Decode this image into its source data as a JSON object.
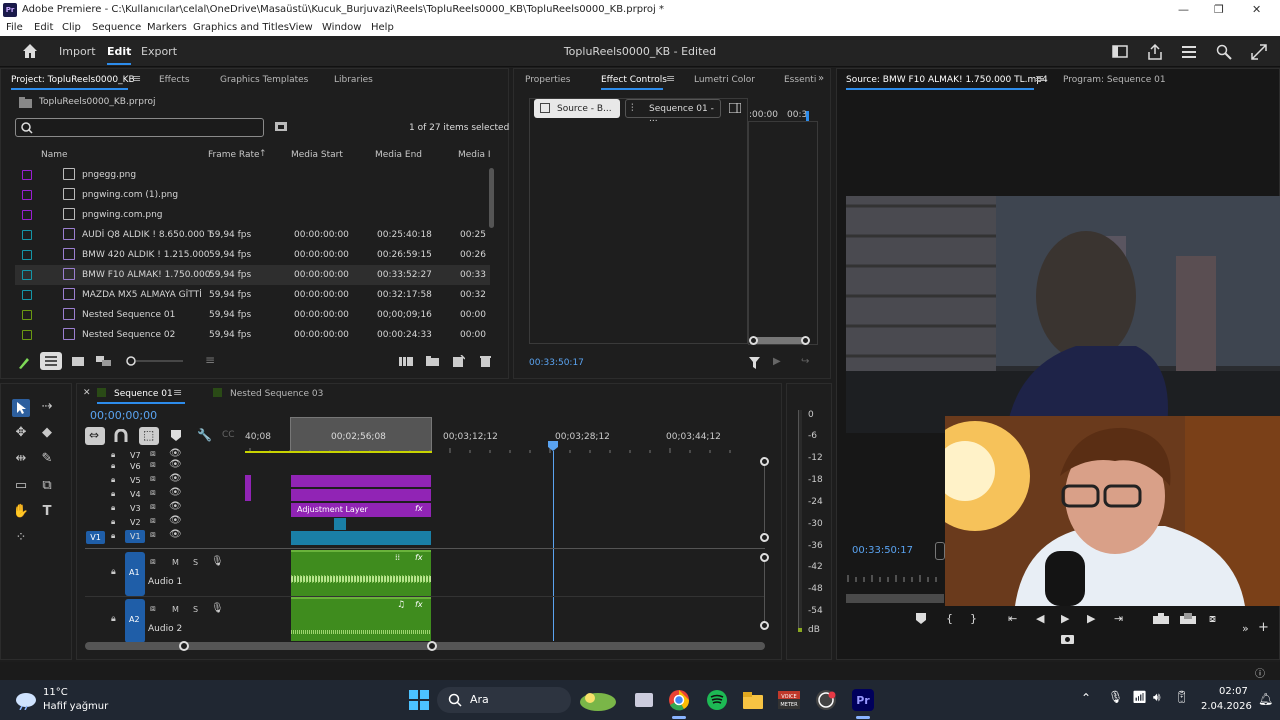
{
  "window": {
    "title": "Adobe Premiere - C:\\Kullanıcılar\\celal\\OneDrive\\Masaüstü\\Kucuk_Burjuvazi\\Reels\\TopluReels0000_KB\\TopluReels0000_KB.prproj *",
    "logo": "Pr"
  },
  "menu": [
    "File",
    "Edit",
    "Clip",
    "Sequence",
    "Markers",
    "Graphics and Titles",
    "View",
    "Window",
    "Help"
  ],
  "header": {
    "import": "Import",
    "edit": "Edit",
    "export": "Export",
    "project_title": "TopluReels0000_KB - Edited"
  },
  "project_panel": {
    "tabs": [
      "Project: TopluReels0000_KB",
      "Effects",
      "Graphics Templates",
      "Libraries"
    ],
    "file": "TopluReels0000_KB.prproj",
    "search_placeholder": "",
    "items_selected": "1 of 27 items selected",
    "columns": [
      "Name",
      "Frame Rate",
      "Media Start",
      "Media End",
      "Media I"
    ],
    "rows": [
      {
        "name": "pngegg.png",
        "fps": "",
        "start": "",
        "end": "",
        "dur": "",
        "color": "#9b1fd4"
      },
      {
        "name": "pngwing.com (1).png",
        "fps": "",
        "start": "",
        "end": "",
        "dur": "",
        "color": "#9b1fd4"
      },
      {
        "name": "pngwing.com.png",
        "fps": "",
        "start": "",
        "end": "",
        "dur": "",
        "color": "#9b1fd4"
      },
      {
        "name": "AUDİ Q8 ALDIK ! 8.650.000 T",
        "fps": "59,94 fps",
        "start": "00:00:00:00",
        "end": "00:25:40:18",
        "dur": "00:25",
        "color": "#1496a8"
      },
      {
        "name": "BMW 420 ALDIK ! 1.215.000",
        "fps": "59,94 fps",
        "start": "00:00:00:00",
        "end": "00:26:59:15",
        "dur": "00:26",
        "color": "#1496a8"
      },
      {
        "name": "BMW F10 ALMAK! 1.750.000",
        "fps": "59,94 fps",
        "start": "00:00:00:00",
        "end": "00:33:52:27",
        "dur": "00:33",
        "color": "#1496a8"
      },
      {
        "name": "MAZDA MX5 ALMAYA GİTTİ",
        "fps": "59,94 fps",
        "start": "00:00:00:00",
        "end": "00:32:17:58",
        "dur": "00:32",
        "color": "#1496a8"
      },
      {
        "name": "Nested Sequence 01",
        "fps": "59,94 fps",
        "start": "00:00:00:00",
        "end": "00;00;09;16",
        "dur": "00:00",
        "color": "#6a9a12"
      },
      {
        "name": "Nested Sequence 02",
        "fps": "59,94 fps",
        "start": "00:00:00:00",
        "end": "00:00:24:33",
        "dur": "00:00",
        "color": "#6a9a12"
      }
    ]
  },
  "effect_panel": {
    "tabs": [
      "Properties",
      "Effect Controls",
      "Lumetri Color",
      "Essenti"
    ],
    "source_btn": "Source - B...",
    "seq_btn": "Sequence 01 - ...",
    "tc_left": ":00:00",
    "tc_right": "00:3",
    "timecode": "00:33:50:17"
  },
  "source_monitor": {
    "tabs": [
      "Source: BMW F10 ALMAK! 1.750.000 TL.mp4",
      "Program: Sequence 01"
    ],
    "timecode": "00:33:50:17"
  },
  "timeline": {
    "tabs": [
      "Sequence 01",
      "Nested Sequence 03"
    ],
    "timecode": "00;00;00;00",
    "ruler": [
      "40;08",
      "00;02;56;08",
      "00;03;12;12",
      "00;03;28;12",
      "00;03;44;12"
    ],
    "tracks_video": [
      "V7",
      "V6",
      "V5",
      "V4",
      "V3",
      "V2",
      "V1"
    ],
    "source_patch": "V1",
    "tracks_audio": [
      {
        "id": "A1",
        "name": "Audio 1"
      },
      {
        "id": "A2",
        "name": "Audio 2"
      }
    ],
    "adjustment_label": "Adjustment Layer",
    "fx": "fx"
  },
  "meter": {
    "scale": [
      "0",
      "-6",
      "-12",
      "-18",
      "-24",
      "-30",
      "-36",
      "-42",
      "-48",
      "-54",
      "dB"
    ]
  },
  "taskbar": {
    "temp": "11°C",
    "weather": "Hafif yağmur",
    "search": "Ara",
    "time": "02:07",
    "date": "2.04.2026"
  },
  "colors": {
    "accent": "#2d8ceb",
    "audio_clip": "#3f8c1e",
    "video_clip": "#1a7fa6",
    "adj_clip": "#9124b5"
  }
}
